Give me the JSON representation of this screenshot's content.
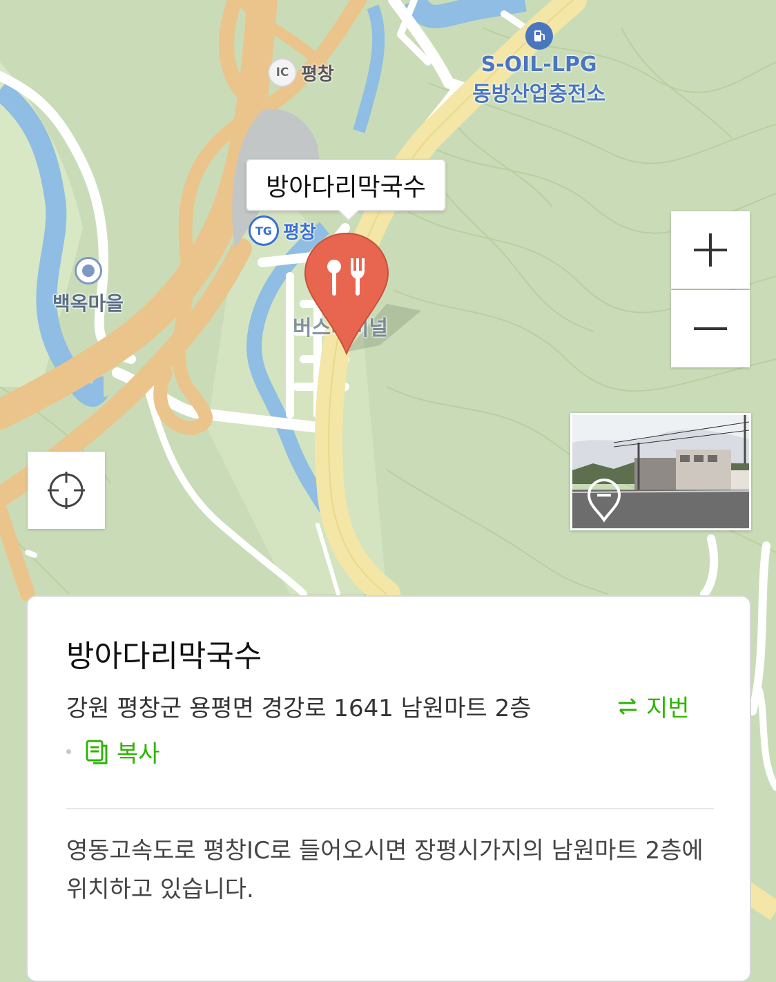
{
  "map": {
    "labels": {
      "ic": "평창",
      "ic_badge": "IC",
      "tg": "평창",
      "tg_badge": "TG",
      "village": "백옥마을",
      "gas_line1": "S-OIL-LPG",
      "gas_line2": "동방산업충전소",
      "terminal": "버스터미널"
    },
    "colors": {
      "terrain": "#c9dcb7",
      "highway": "#ebc48c",
      "road": "#ffffff",
      "river": "#8fbde3",
      "marker": "#e8654f"
    }
  },
  "place": {
    "name": "방아다리막국수",
    "address": "강원 평창군 용평면 경강로 1641 남원마트 2층",
    "jibun_label": "지번",
    "copy_label": "복사",
    "description": "영동고속도로 평창IC로 들어오시면 장평시가지의 남원마트 2층에 위치하고 있습니다."
  },
  "icons": {
    "zoom_in": "plus-icon",
    "zoom_out": "minus-icon",
    "locate": "crosshair-icon",
    "marker": "restaurant-marker-icon",
    "gas": "gas-station-icon",
    "jibun": "swap-arrows-icon",
    "copy": "copy-icon"
  }
}
